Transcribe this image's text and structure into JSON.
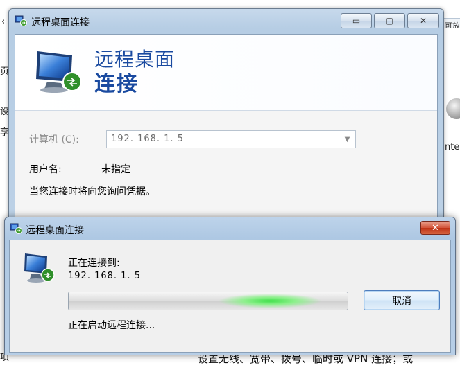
{
  "background": {
    "left_strip_chars": [
      "页",
      "设",
      "享"
    ],
    "right_tab_text": "可放",
    "right_text": "nte",
    "top_chevron": "‹",
    "bottom_text": "设置无线、宽带、拨号、临时或 VPN 连接；或",
    "bottom_left_char": "项"
  },
  "main_window": {
    "title": "远程桌面连接",
    "banner_line1": "远程桌面",
    "banner_line2": "连接",
    "computer_label": "计算机 (C):",
    "computer_value": "192. 168. 1. 5",
    "user_label": "用户名:",
    "user_value": "未指定",
    "hint": "当您连接时将向您询问凭据。",
    "buttons": {
      "minimize": "▭",
      "maximize": "▢",
      "close": "✕"
    }
  },
  "dialog": {
    "title": "远程桌面连接",
    "close_label": "✕",
    "connecting_label": "正在连接到:",
    "address": "192. 168. 1. 5",
    "progress_indeterminate": true,
    "cancel_label": "取消",
    "status": "正在启动远程连接..."
  },
  "colors": {
    "banner_text": "#1a4aa0",
    "progress_glow": "#3fe04a",
    "close_red": "#c7391c"
  }
}
